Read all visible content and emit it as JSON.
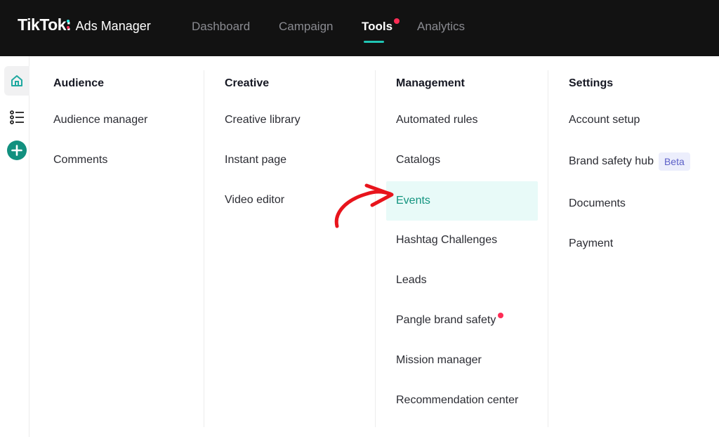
{
  "brand": {
    "name": "TikTok",
    "colon": ":",
    "product": "Ads Manager"
  },
  "nav": {
    "items": [
      {
        "label": "Dashboard"
      },
      {
        "label": "Campaign"
      },
      {
        "label": "Tools",
        "active": true,
        "notification": true
      },
      {
        "label": "Analytics"
      }
    ]
  },
  "rail": {
    "icons": [
      "home-icon",
      "list-icon",
      "add-circle-icon"
    ]
  },
  "menu": {
    "columns": [
      {
        "title": "Audience",
        "items": [
          "Audience manager",
          "Comments"
        ]
      },
      {
        "title": "Creative",
        "items": [
          "Creative library",
          "Instant page",
          "Video editor"
        ]
      },
      {
        "title": "Management",
        "items": [
          "Automated rules",
          "Catalogs",
          "Events",
          "Hashtag Challenges",
          "Leads",
          "Pangle brand safety",
          "Mission manager",
          "Recommendation center"
        ]
      },
      {
        "title": "Settings",
        "items": [
          "Account setup",
          "Brand safety hub",
          "Documents",
          "Payment"
        ],
        "badge": "Beta"
      }
    ],
    "highlighted_item": "Events"
  },
  "colors": {
    "topbar": "#121212",
    "accent": "#20c5b4",
    "notification": "#fe2c55",
    "highlight_bg": "#e8faf8",
    "highlight_text": "#12947f",
    "annotation_arrow": "#e8141c"
  }
}
